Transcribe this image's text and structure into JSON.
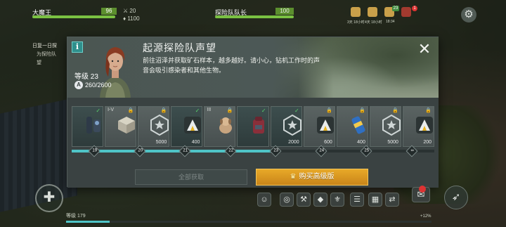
{
  "hud": {
    "player_name": "大魔王",
    "player_hp": "96",
    "stat_top": "20",
    "stat_bottom": "1100",
    "leader_name": "探险队队长",
    "leader_hp": "100",
    "counter": "23",
    "gift_badge": "1",
    "timers": [
      "3天 18小时",
      "4天 18小时",
      "18:34"
    ]
  },
  "quest": {
    "title": "日复一日探",
    "sub": "为探险队",
    "sub2": "望"
  },
  "modal": {
    "info_icon": "i",
    "title": "起源探险队声望",
    "description": "前往沼泽并获取矿石样本，越多越好。请小心，钻机工作时的声音会吸引感染者和其他生物。",
    "level_label": "等级 23",
    "xp": "260/2600",
    "close": "✕",
    "claim_all": "全部获取",
    "buy_premium": "购买高级版",
    "accent": "#4fc4c7",
    "premium_color": "#e8a928"
  },
  "rewards": [
    {
      "icon": "dark-gadgets-icon",
      "qty": "",
      "tag": "",
      "status": "check",
      "level": "19"
    },
    {
      "icon": "supply-crate-icon",
      "qty": "",
      "tag": "I-V",
      "status": "lock",
      "level": "20"
    },
    {
      "icon": "star-badge-icon",
      "qty": "5000",
      "tag": "",
      "status": "lock",
      "level": "20"
    },
    {
      "icon": "expedition-token-icon",
      "qty": "400",
      "tag": "",
      "status": "check",
      "level": "21"
    },
    {
      "icon": "dog-icon",
      "qty": "",
      "tag": "III",
      "status": "lock",
      "level": "22"
    },
    {
      "icon": "backpack-icon",
      "qty": "",
      "tag": "",
      "status": "check",
      "level": "22"
    },
    {
      "icon": "star-badge-icon",
      "qty": "2000",
      "tag": "",
      "status": "check",
      "level": "23"
    },
    {
      "icon": "expedition-token-icon",
      "qty": "600",
      "tag": "",
      "status": "lock",
      "level": "24"
    },
    {
      "icon": "energy-can-icon",
      "qty": "400",
      "tag": "",
      "status": "lock",
      "level": "24"
    },
    {
      "icon": "star-badge-icon",
      "qty": "5000",
      "tag": "",
      "status": "lock",
      "level": "25"
    },
    {
      "icon": "expedition-token-icon",
      "qty": "200",
      "tag": "",
      "status": "lock",
      "level": "∞"
    }
  ],
  "levels": [
    "19",
    "20",
    "21",
    "22",
    "23",
    "24",
    "25",
    "∞"
  ],
  "progress_fraction": 0.56,
  "bottom": {
    "exp_label": "等级 179",
    "exp_pct": "+12%",
    "exp_fraction": 0.12
  }
}
